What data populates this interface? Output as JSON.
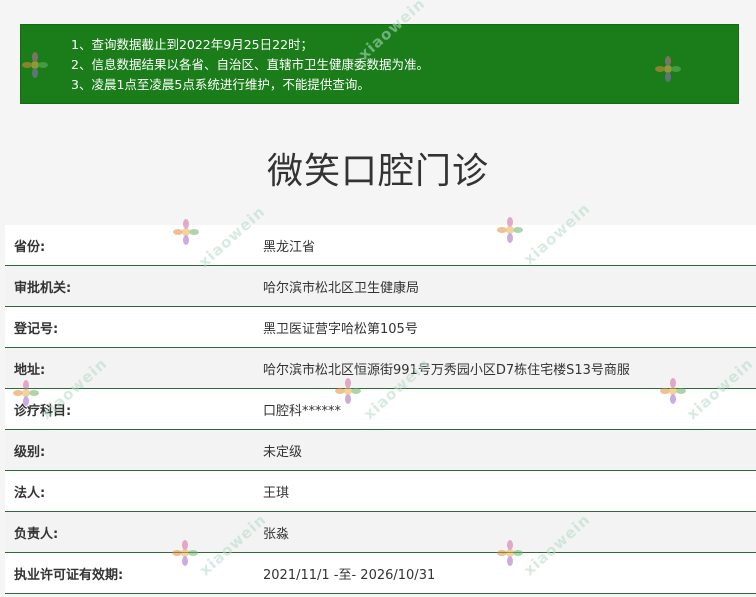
{
  "notice": {
    "lines": [
      "1、查询数据截止到2022年9月25日22时；",
      "2、信息数据结果以各省、自治区、直辖市卫生健康委数据为准。",
      "3、凌晨1点至凌晨5点系统进行维护，不能提供查询。"
    ],
    "background": "#1a7d1a"
  },
  "title": "微笑口腔门诊",
  "table": {
    "rows": [
      {
        "label": "省份:",
        "value": "黑龙江省"
      },
      {
        "label": "审批机关:",
        "value": "哈尔滨市松北区卫生健康局"
      },
      {
        "label": "登记号:",
        "value": "黑卫医证营字哈松第105号"
      },
      {
        "label": "地址:",
        "value": "哈尔滨市松北区恒源街991号万秀园小区D7栋住宅楼S13号商服"
      },
      {
        "label": "诊疗科目:",
        "value": "口腔科******"
      },
      {
        "label": "级别:",
        "value": "未定级"
      },
      {
        "label": "法人:",
        "value": "王琪"
      },
      {
        "label": "负责人:",
        "value": "张淼"
      },
      {
        "label": "执业许可证有效期:",
        "value": "2021/11/1 -至- 2026/10/31"
      }
    ],
    "border_color": "#2e6b3a"
  },
  "watermark": {
    "text": "xiaowein",
    "icon": "flower-logo-icon"
  }
}
